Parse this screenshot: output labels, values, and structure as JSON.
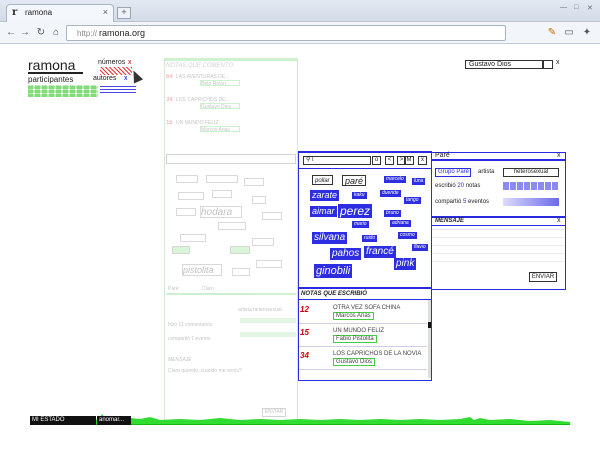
{
  "browser": {
    "tab_title": "ramona",
    "tab_icon": "r",
    "url_scheme": "http://",
    "url_host": "ramona.org"
  },
  "app": {
    "logo": "ramona",
    "participantes_label": "participantes",
    "numeros_label": "números",
    "autores_label": "autores",
    "close_x": "x",
    "user": "Gustavo Dios"
  },
  "faded": {
    "title": "NOTAS QUE COMENTÓ",
    "notes": [
      {
        "num": "54",
        "title": "LAS AVENTURAS DE...",
        "author": "Beto Rolán"
      },
      {
        "num": "34",
        "title": "LOS CAPRICHOS DE...",
        "author": "Gustavo Dios"
      },
      {
        "num": "15",
        "title": "UN MUNDO FELIZ",
        "author": "Marcos Arias"
      }
    ],
    "words": [
      "pistolita",
      "hodara"
    ],
    "field": "Paré",
    "cinco": "Claro",
    "artista": "artista heterosexual",
    "comentarios": "hizo 11 comentarios",
    "compartio": "compartió 1 evento",
    "mensaje": "MENSAJE",
    "mensaje_text": "Claro querido, cuando me venís?",
    "enviar": "ENVIAR"
  },
  "wordcloud": {
    "search_value": "l",
    "controls": [
      "o",
      "<",
      ">",
      "M",
      "x"
    ],
    "words": [
      {
        "t": "pollar",
        "boxed": true
      },
      {
        "t": "paré",
        "boxed": true
      },
      {
        "t": "zarate",
        "boxed": false
      },
      {
        "t": "perez",
        "boxed": false
      },
      {
        "t": "aimar",
        "boxed": false
      },
      {
        "t": "silvana",
        "boxed": false
      },
      {
        "t": "pahos",
        "boxed": false
      },
      {
        "t": "francé",
        "boxed": false
      },
      {
        "t": "pink",
        "boxed": false
      },
      {
        "t": "ginobili",
        "boxed": false
      },
      {
        "t": "kaku",
        "boxed": false
      },
      {
        "t": "mario",
        "boxed": false
      },
      {
        "t": "adriana",
        "boxed": false
      },
      {
        "t": "bruno",
        "boxed": false
      },
      {
        "t": "marcelo",
        "boxed": false
      },
      {
        "t": "duende",
        "boxed": false
      },
      {
        "t": "tango",
        "boxed": false
      },
      {
        "t": "cosmo",
        "boxed": false
      },
      {
        "t": "luna",
        "boxed": false
      },
      {
        "t": "ruido",
        "boxed": false
      },
      {
        "t": "flavio",
        "boxed": false
      }
    ]
  },
  "pare": {
    "title": "Paré",
    "close": "x",
    "grupo": "Grupo Paré",
    "artista": "artista",
    "hetero": "heterosexual",
    "escribio_pre": "escribió",
    "escribio_num": "20",
    "escribio_post": "notas",
    "compartio_pre": "compartió",
    "compartio_num": "5",
    "compartio_post": "eventos"
  },
  "mensaje": {
    "title": "MENSAJE",
    "close": "x",
    "enviar": "ENVIAR"
  },
  "notas": {
    "title": "NOTAS QUE ESCRIBIÓ",
    "items": [
      {
        "num": "12",
        "title": "OTRA VEZ SOFA CHINA",
        "author": "Marcos Arias"
      },
      {
        "num": "15",
        "title": "UN MUNDO FELIZ",
        "author": "Fabio Pistolita"
      },
      {
        "num": "34",
        "title": "LOS CAPRICHOS DE LA NOVIA",
        "author": "Gustavo Dios"
      }
    ]
  },
  "bottom": {
    "estado": "MI ESTADO",
    "anomar": "anomar..."
  },
  "colors": {
    "accent_blue": "#2a2ae0",
    "accent_green": "#3cc13c",
    "note_red": "#cc0000"
  }
}
